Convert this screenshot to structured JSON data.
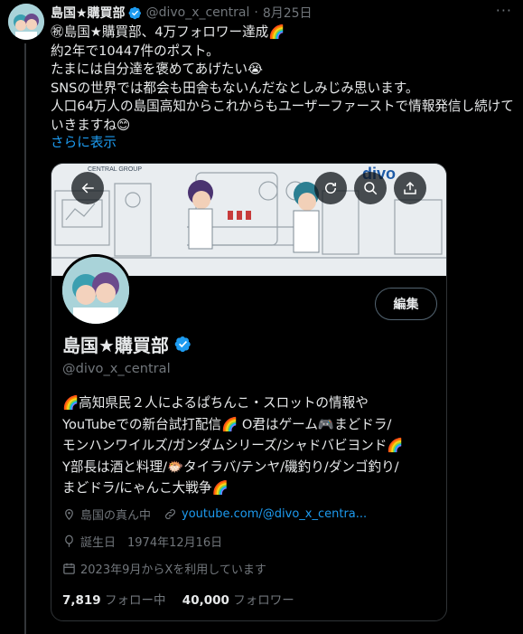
{
  "post": {
    "display_name": "島国★購買部",
    "handle": "@divo_x_central",
    "separator": "·",
    "date": "8月25日",
    "more_label": "···",
    "text": "㊗島国★購買部、4万フォロワー達成🌈\n約2年で10447件のポスト。\nたまには自分達を褒めてあげたい😭\nSNSの世界では都会も田舎もないんだなとしみじみ思います。\n人口64万人の島国高知からこれからもユーザーファーストで情報発信し続けていきますね😊",
    "show_more": "さらに表示"
  },
  "card": {
    "banner": {
      "brand": "divo",
      "group_label": "CENTRAL GROUP"
    },
    "edit_button": "編集",
    "profile_name": "島国★購買部",
    "profile_handle": "@divo_x_central",
    "bio": "🌈高知県民２人によるぱちんこ・スロットの情報や\nYouTubeでの新台試打配信🌈 O君はゲーム🎮まどドラ/\nモンハンワイルズ/ガンダムシリーズ/シャドバビヨンド🌈\nY部長は酒と料理/🐡タイラバ/テンヤ/磯釣り/ダンゴ釣り/\nまどドラ/にゃんこ大戦争🌈",
    "location": "島国の真ん中",
    "url": "youtube.com/@divo_x_centra...",
    "birthday": "誕生日　1974年12月16日",
    "joined": "2023年9月からXを利用しています",
    "following_count": "7,819",
    "following_label": "フォロー中",
    "followers_count": "40,000",
    "followers_label": "フォロワー"
  },
  "colors": {
    "background": "#000000",
    "text": "#e7e9ea",
    "muted": "#71767b",
    "link": "#1d9bf0",
    "border": "#2f3336"
  },
  "icons": [
    "verified-badge-icon",
    "more-icon",
    "back-arrow-icon",
    "refresh-icon",
    "search-icon",
    "share-icon",
    "location-icon",
    "link-icon",
    "balloon-icon",
    "calendar-icon"
  ]
}
